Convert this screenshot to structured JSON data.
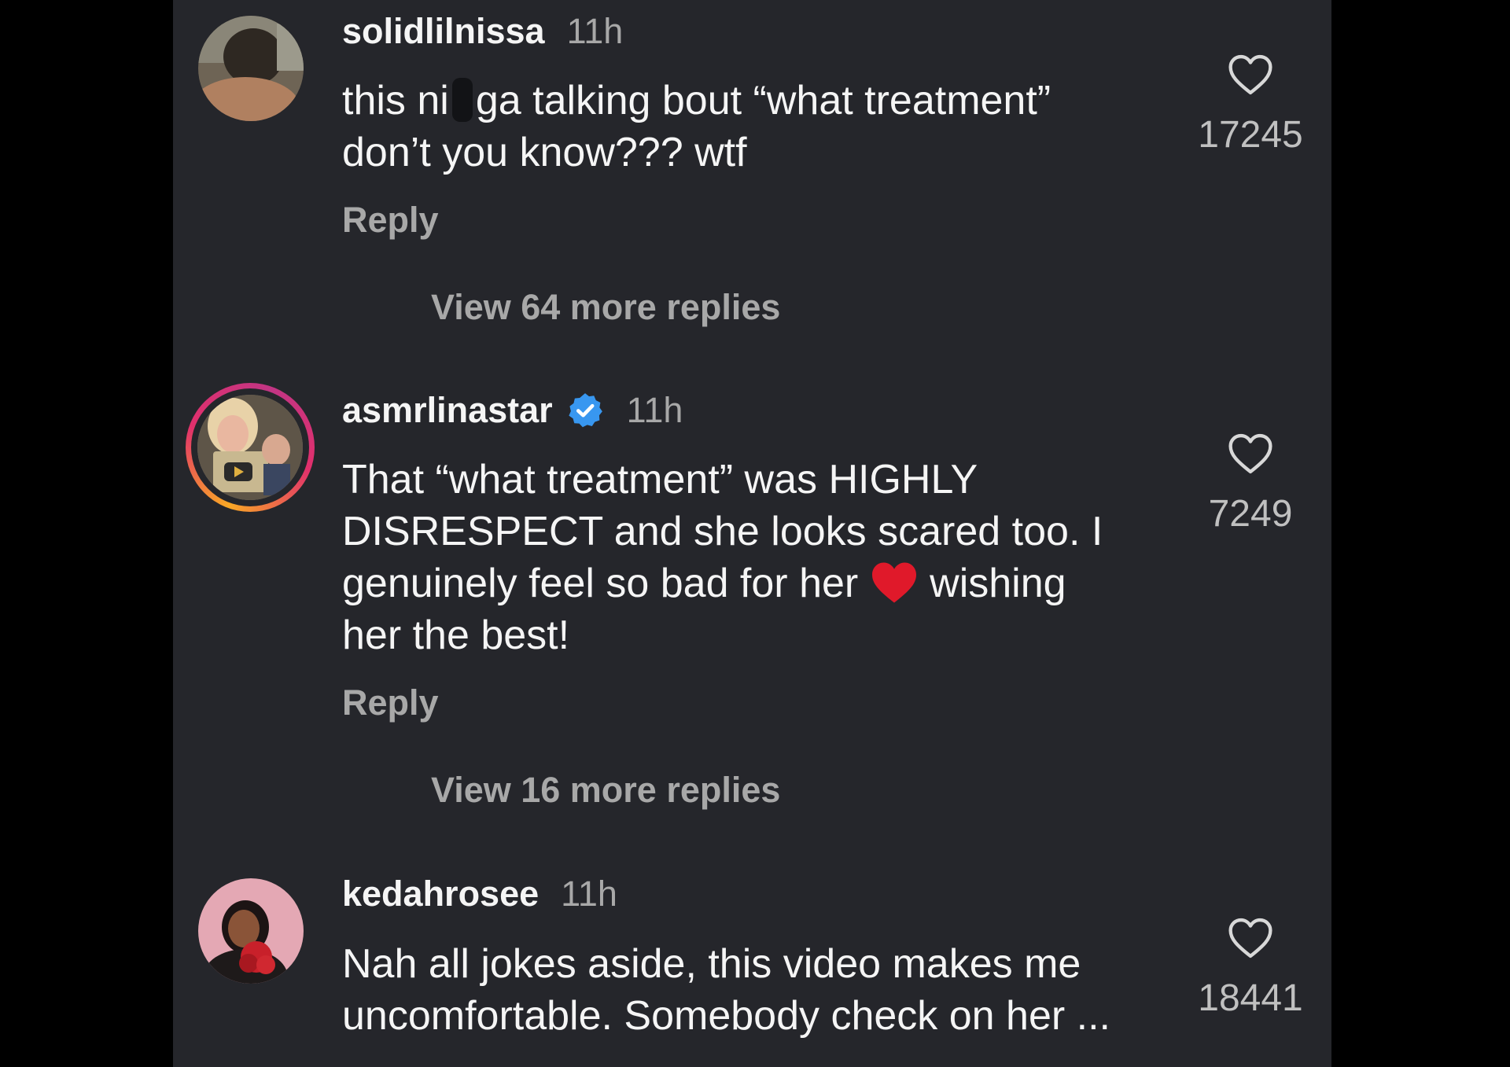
{
  "comments": [
    {
      "username": "solidlilnissa",
      "time": "11h",
      "text_a": "this ni",
      "text_b": "ga talking bout “what treatment” don’t you know??? wtf",
      "reply_label": "Reply",
      "likes": "17245",
      "view_more": "View 64 more replies"
    },
    {
      "username": "asmrlinastar",
      "verified": true,
      "time": "11h",
      "text_a": "That “what treatment” was HIGHLY DISRESPECT and she looks scared too. I genuinely feel so bad for her",
      "emoji": "❤️",
      "text_b": "wishing her the best!",
      "reply_label": "Reply",
      "likes": "7249",
      "view_more": "View 16 more replies"
    },
    {
      "username": "kedahrosee",
      "time": "11h",
      "text_a": "Nah all jokes aside, this video makes me uncomfortable. Somebody check on her ...",
      "likes": "18441"
    }
  ],
  "icons": {
    "like": "heart-outline-icon",
    "verified": "verified-badge-icon",
    "story_ring": "story-ring",
    "video": "youtube-play-icon"
  },
  "colors": {
    "background": "#25262b",
    "text": "#f5f5f5",
    "secondary_text": "#a8a8a8",
    "verified_blue": "#3897f0",
    "heart_red": "#e0192a"
  }
}
